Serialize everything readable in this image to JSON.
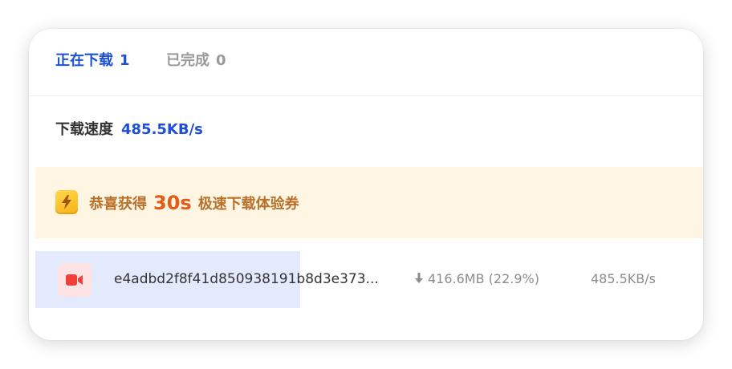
{
  "tabs": [
    {
      "label": "正在下载",
      "count": "1",
      "active": true
    },
    {
      "label": "已完成",
      "count": "0",
      "active": false
    }
  ],
  "speed": {
    "label": "下载速度",
    "value": "485.5KB/s"
  },
  "promo": {
    "icon": "lightning-icon",
    "prefix": "恭喜获得",
    "amount": "30s",
    "suffix": "极速下载体验券"
  },
  "downloads": [
    {
      "icon": "video-file-icon",
      "name": "e4adbd2f8f41d850938191b8d3e373...",
      "size": "416.6MB (22.9%)",
      "progress": 0.229,
      "speed": "485.5KB/s"
    }
  ],
  "colors": {
    "accent": "#1d4fd7",
    "promo_bg": "#fef6e3",
    "promo_text": "#b8702a",
    "promo_amount": "#e55a14",
    "progress_fill": "#e3eafd"
  }
}
